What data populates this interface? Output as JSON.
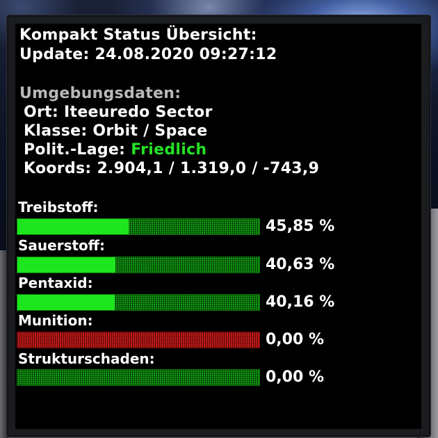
{
  "header": {
    "title": "Kompakt Status Übersicht:",
    "update": "Update: 24.08.2020 09:27:12"
  },
  "environment": {
    "heading": "Umgebungsdaten:",
    "ort": "Ort: Iteeuredo Sector",
    "klasse": "Klasse: Orbit / Space",
    "polit_label": "Polit.-Lage: ",
    "polit_value": "Friedlich",
    "koords": "Koords: 2.904,1 / 1.319,0 / -743,9"
  },
  "bars": [
    {
      "label": "Treibstoff:",
      "percent_text": "45,85 %",
      "fill_fraction": 0.4585,
      "status_color": "#1ee61e"
    },
    {
      "label": "Sauerstoff:",
      "percent_text": "40,63 %",
      "fill_fraction": 0.4063,
      "status_color": "#1ee61e"
    },
    {
      "label": "Pentaxid:",
      "percent_text": "40,16 %",
      "fill_fraction": 0.4016,
      "status_color": "#1ee61e"
    },
    {
      "label": "Munition:",
      "percent_text": "0,00 %",
      "fill_fraction": 0.0,
      "status_color": "#d21a1a"
    },
    {
      "label": "Strukturschaden:",
      "percent_text": "0,00 %",
      "fill_fraction": 0.0,
      "status_color": "#1ee61e"
    }
  ],
  "colors": {
    "accent_green": "#24e024",
    "bar_green": "#1ee61e",
    "bar_red": "#d21a1a",
    "heading_gray": "#b9b9b9"
  }
}
